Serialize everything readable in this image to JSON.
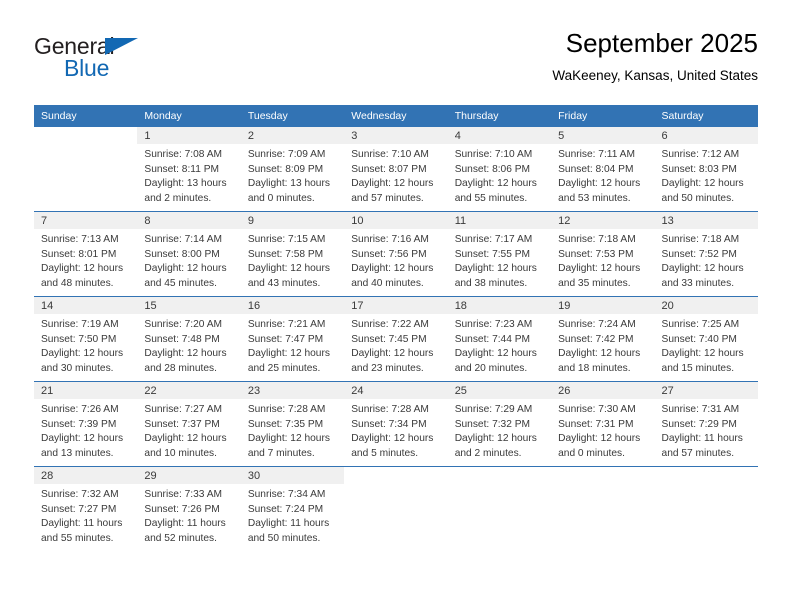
{
  "brand": {
    "word_one": "General",
    "word_two": "Blue",
    "accent_color": "#1268b3",
    "triangle_icon": "triangle-icon"
  },
  "header": {
    "title": "September 2025",
    "location": "WaKeeney, Kansas, United States"
  },
  "calendar": {
    "header_bg": "#3273b4",
    "daynum_band_bg": "#f0f0f0",
    "weekday_headers": [
      "Sunday",
      "Monday",
      "Tuesday",
      "Wednesday",
      "Thursday",
      "Friday",
      "Saturday"
    ],
    "weeks": [
      [
        {
          "day": "",
          "lines": []
        },
        {
          "day": "1",
          "lines": [
            "Sunrise: 7:08 AM",
            "Sunset: 8:11 PM",
            "Daylight: 13 hours",
            "and 2 minutes."
          ]
        },
        {
          "day": "2",
          "lines": [
            "Sunrise: 7:09 AM",
            "Sunset: 8:09 PM",
            "Daylight: 13 hours",
            "and 0 minutes."
          ]
        },
        {
          "day": "3",
          "lines": [
            "Sunrise: 7:10 AM",
            "Sunset: 8:07 PM",
            "Daylight: 12 hours",
            "and 57 minutes."
          ]
        },
        {
          "day": "4",
          "lines": [
            "Sunrise: 7:10 AM",
            "Sunset: 8:06 PM",
            "Daylight: 12 hours",
            "and 55 minutes."
          ]
        },
        {
          "day": "5",
          "lines": [
            "Sunrise: 7:11 AM",
            "Sunset: 8:04 PM",
            "Daylight: 12 hours",
            "and 53 minutes."
          ]
        },
        {
          "day": "6",
          "lines": [
            "Sunrise: 7:12 AM",
            "Sunset: 8:03 PM",
            "Daylight: 12 hours",
            "and 50 minutes."
          ]
        }
      ],
      [
        {
          "day": "7",
          "lines": [
            "Sunrise: 7:13 AM",
            "Sunset: 8:01 PM",
            "Daylight: 12 hours",
            "and 48 minutes."
          ]
        },
        {
          "day": "8",
          "lines": [
            "Sunrise: 7:14 AM",
            "Sunset: 8:00 PM",
            "Daylight: 12 hours",
            "and 45 minutes."
          ]
        },
        {
          "day": "9",
          "lines": [
            "Sunrise: 7:15 AM",
            "Sunset: 7:58 PM",
            "Daylight: 12 hours",
            "and 43 minutes."
          ]
        },
        {
          "day": "10",
          "lines": [
            "Sunrise: 7:16 AM",
            "Sunset: 7:56 PM",
            "Daylight: 12 hours",
            "and 40 minutes."
          ]
        },
        {
          "day": "11",
          "lines": [
            "Sunrise: 7:17 AM",
            "Sunset: 7:55 PM",
            "Daylight: 12 hours",
            "and 38 minutes."
          ]
        },
        {
          "day": "12",
          "lines": [
            "Sunrise: 7:18 AM",
            "Sunset: 7:53 PM",
            "Daylight: 12 hours",
            "and 35 minutes."
          ]
        },
        {
          "day": "13",
          "lines": [
            "Sunrise: 7:18 AM",
            "Sunset: 7:52 PM",
            "Daylight: 12 hours",
            "and 33 minutes."
          ]
        }
      ],
      [
        {
          "day": "14",
          "lines": [
            "Sunrise: 7:19 AM",
            "Sunset: 7:50 PM",
            "Daylight: 12 hours",
            "and 30 minutes."
          ]
        },
        {
          "day": "15",
          "lines": [
            "Sunrise: 7:20 AM",
            "Sunset: 7:48 PM",
            "Daylight: 12 hours",
            "and 28 minutes."
          ]
        },
        {
          "day": "16",
          "lines": [
            "Sunrise: 7:21 AM",
            "Sunset: 7:47 PM",
            "Daylight: 12 hours",
            "and 25 minutes."
          ]
        },
        {
          "day": "17",
          "lines": [
            "Sunrise: 7:22 AM",
            "Sunset: 7:45 PM",
            "Daylight: 12 hours",
            "and 23 minutes."
          ]
        },
        {
          "day": "18",
          "lines": [
            "Sunrise: 7:23 AM",
            "Sunset: 7:44 PM",
            "Daylight: 12 hours",
            "and 20 minutes."
          ]
        },
        {
          "day": "19",
          "lines": [
            "Sunrise: 7:24 AM",
            "Sunset: 7:42 PM",
            "Daylight: 12 hours",
            "and 18 minutes."
          ]
        },
        {
          "day": "20",
          "lines": [
            "Sunrise: 7:25 AM",
            "Sunset: 7:40 PM",
            "Daylight: 12 hours",
            "and 15 minutes."
          ]
        }
      ],
      [
        {
          "day": "21",
          "lines": [
            "Sunrise: 7:26 AM",
            "Sunset: 7:39 PM",
            "Daylight: 12 hours",
            "and 13 minutes."
          ]
        },
        {
          "day": "22",
          "lines": [
            "Sunrise: 7:27 AM",
            "Sunset: 7:37 PM",
            "Daylight: 12 hours",
            "and 10 minutes."
          ]
        },
        {
          "day": "23",
          "lines": [
            "Sunrise: 7:28 AM",
            "Sunset: 7:35 PM",
            "Daylight: 12 hours",
            "and 7 minutes."
          ]
        },
        {
          "day": "24",
          "lines": [
            "Sunrise: 7:28 AM",
            "Sunset: 7:34 PM",
            "Daylight: 12 hours",
            "and 5 minutes."
          ]
        },
        {
          "day": "25",
          "lines": [
            "Sunrise: 7:29 AM",
            "Sunset: 7:32 PM",
            "Daylight: 12 hours",
            "and 2 minutes."
          ]
        },
        {
          "day": "26",
          "lines": [
            "Sunrise: 7:30 AM",
            "Sunset: 7:31 PM",
            "Daylight: 12 hours",
            "and 0 minutes."
          ]
        },
        {
          "day": "27",
          "lines": [
            "Sunrise: 7:31 AM",
            "Sunset: 7:29 PM",
            "Daylight: 11 hours",
            "and 57 minutes."
          ]
        }
      ],
      [
        {
          "day": "28",
          "lines": [
            "Sunrise: 7:32 AM",
            "Sunset: 7:27 PM",
            "Daylight: 11 hours",
            "and 55 minutes."
          ]
        },
        {
          "day": "29",
          "lines": [
            "Sunrise: 7:33 AM",
            "Sunset: 7:26 PM",
            "Daylight: 11 hours",
            "and 52 minutes."
          ]
        },
        {
          "day": "30",
          "lines": [
            "Sunrise: 7:34 AM",
            "Sunset: 7:24 PM",
            "Daylight: 11 hours",
            "and 50 minutes."
          ]
        },
        {
          "day": "",
          "lines": []
        },
        {
          "day": "",
          "lines": []
        },
        {
          "day": "",
          "lines": []
        },
        {
          "day": "",
          "lines": []
        }
      ]
    ]
  }
}
